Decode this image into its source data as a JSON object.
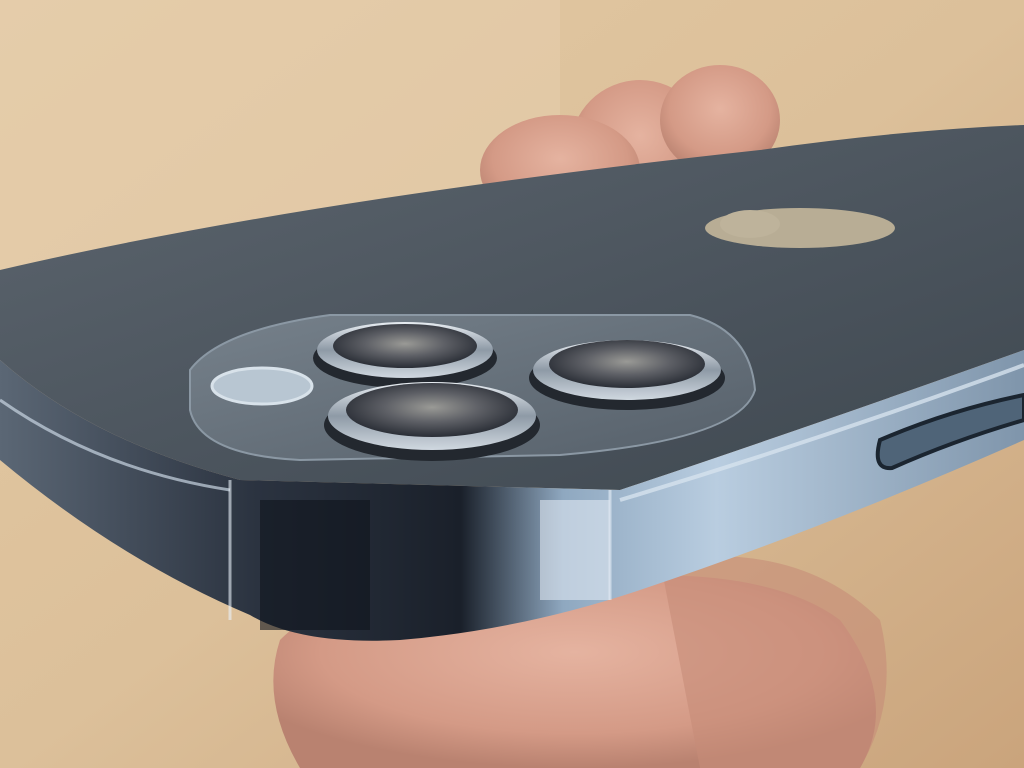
{
  "scene": {
    "subject": "phone-camera-closeup",
    "colors": {
      "background_light": "#e6cda8",
      "background_dark": "#c9a47a",
      "hand_skin": "#d9a08c",
      "hand_shadow": "#b97e6c",
      "phone_back": "#4c545c",
      "phone_back_light": "#66707a",
      "frame_steel": "#9fb4c8",
      "frame_dark": "#1d2430",
      "frame_highlight": "#e8f0f8",
      "camera_bump": "#5d6770",
      "lens_ring": "#c0c8d0",
      "lens_glass": "#3a3f46",
      "apple_logo": "#c6b9a0"
    },
    "icons": [
      "apple-logo-icon"
    ]
  }
}
